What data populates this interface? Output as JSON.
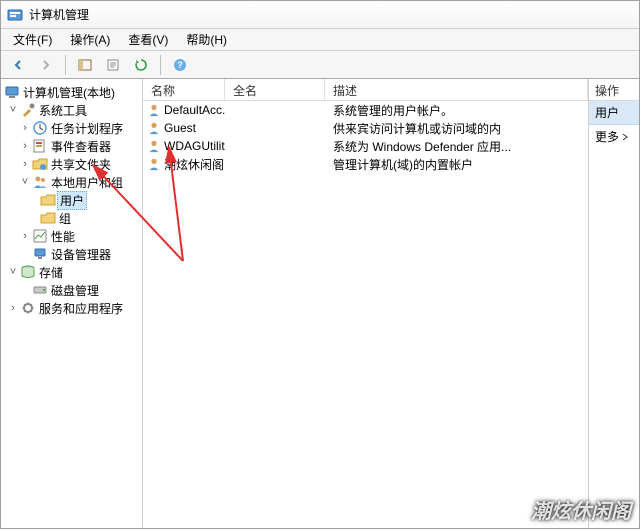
{
  "window": {
    "title": "计算机管理"
  },
  "menubar": {
    "file": "文件(F)",
    "action": "操作(A)",
    "view": "查看(V)",
    "help": "帮助(H)"
  },
  "tree": {
    "root": "计算机管理(本地)",
    "system_tools": "系统工具",
    "task_scheduler": "任务计划程序",
    "event_viewer": "事件查看器",
    "shared_folders": "共享文件夹",
    "local_users_groups": "本地用户和组",
    "users": "用户",
    "groups": "组",
    "performance": "性能",
    "device_manager": "设备管理器",
    "storage": "存储",
    "disk_management": "磁盘管理",
    "services_apps": "服务和应用程序"
  },
  "list": {
    "headers": {
      "name": "名称",
      "fullname": "全名",
      "description": "描述"
    },
    "rows": [
      {
        "name": "DefaultAcc...",
        "fullname": "",
        "desc": "系统管理的用户帐户。"
      },
      {
        "name": "Guest",
        "fullname": "",
        "desc": "供来宾访问计算机或访问域的内"
      },
      {
        "name": "WDAGUtilit...",
        "fullname": "",
        "desc": "系统为 Windows Defender 应用..."
      },
      {
        "name": "潮炫休闲阁",
        "fullname": "",
        "desc": "管理计算机(域)的内置帐户"
      }
    ]
  },
  "actions": {
    "header": "操作",
    "highlight": "用户",
    "more": "更多"
  },
  "watermark": "潮炫休闲阁"
}
